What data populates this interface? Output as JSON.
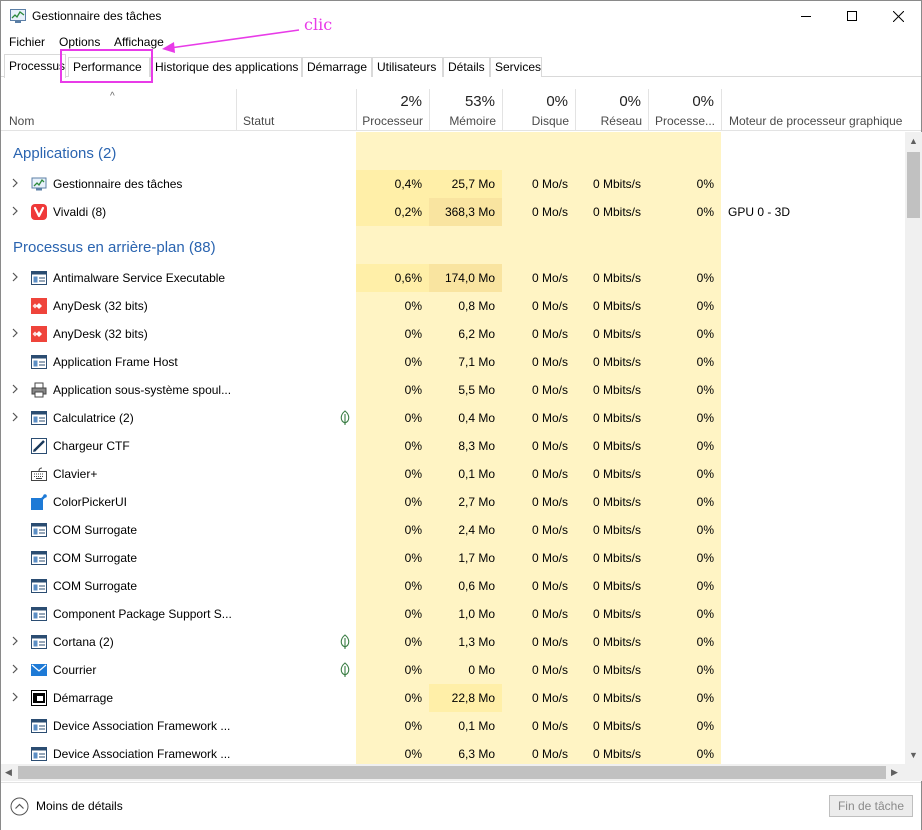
{
  "window": {
    "title": "Gestionnaire des tâches",
    "annotation_label": "clic"
  },
  "menu": [
    "Fichier",
    "Options",
    "Affichage"
  ],
  "tabs": [
    {
      "label": "Processus",
      "active": true
    },
    {
      "label": "Performance",
      "highlighted": true
    },
    {
      "label": "Historique des applications"
    },
    {
      "label": "Démarrage"
    },
    {
      "label": "Utilisateurs"
    },
    {
      "label": "Détails"
    },
    {
      "label": "Services"
    }
  ],
  "columns": {
    "name": "Nom",
    "status": "Statut",
    "cpu": {
      "pct": "2%",
      "label": "Processeur"
    },
    "memory": {
      "pct": "53%",
      "label": "Mémoire"
    },
    "disk": {
      "pct": "0%",
      "label": "Disque"
    },
    "network": {
      "pct": "0%",
      "label": "Réseau"
    },
    "gpu": {
      "pct": "0%",
      "label": "Processe..."
    },
    "gpu_engine": "Moteur de processeur graphique"
  },
  "groups": [
    {
      "label": "Applications (2)",
      "rows": [
        {
          "name": "Gestionnaire des tâches",
          "icon": "task-manager-icon",
          "expandable": true,
          "cpu": "0,4%",
          "mem": "25,7 Mo",
          "disk": "0 Mo/s",
          "net": "0 Mbits/s",
          "gpu": "0%",
          "gpu_engine": ""
        },
        {
          "name": "Vivaldi (8)",
          "icon": "vivaldi-icon",
          "expandable": true,
          "cpu": "0,2%",
          "mem": "368,3 Mo",
          "disk": "0 Mo/s",
          "net": "0 Mbits/s",
          "gpu": "0%",
          "gpu_engine": "GPU 0 - 3D"
        }
      ]
    },
    {
      "label": "Processus en arrière-plan (88)",
      "rows": [
        {
          "name": "Antimalware Service Executable",
          "icon": "service-window-icon",
          "expandable": true,
          "cpu": "0,6%",
          "mem": "174,0 Mo",
          "disk": "0 Mo/s",
          "net": "0 Mbits/s",
          "gpu": "0%"
        },
        {
          "name": "AnyDesk (32 bits)",
          "icon": "anydesk-icon",
          "expandable": false,
          "cpu": "0%",
          "mem": "0,8 Mo",
          "disk": "0 Mo/s",
          "net": "0 Mbits/s",
          "gpu": "0%"
        },
        {
          "name": "AnyDesk (32 bits)",
          "icon": "anydesk-icon",
          "expandable": true,
          "cpu": "0%",
          "mem": "6,2 Mo",
          "disk": "0 Mo/s",
          "net": "0 Mbits/s",
          "gpu": "0%"
        },
        {
          "name": "Application Frame Host",
          "icon": "service-window-icon",
          "expandable": false,
          "cpu": "0%",
          "mem": "7,1 Mo",
          "disk": "0 Mo/s",
          "net": "0 Mbits/s",
          "gpu": "0%"
        },
        {
          "name": "Application sous-système spoul...",
          "icon": "printer-icon",
          "expandable": true,
          "cpu": "0%",
          "mem": "5,5 Mo",
          "disk": "0 Mo/s",
          "net": "0 Mbits/s",
          "gpu": "0%"
        },
        {
          "name": "Calculatrice (2)",
          "icon": "service-window-icon",
          "expandable": true,
          "suspended": true,
          "cpu": "0%",
          "mem": "0,4 Mo",
          "disk": "0 Mo/s",
          "net": "0 Mbits/s",
          "gpu": "0%"
        },
        {
          "name": "Chargeur CTF",
          "icon": "pen-icon",
          "expandable": false,
          "cpu": "0%",
          "mem": "8,3 Mo",
          "disk": "0 Mo/s",
          "net": "0 Mbits/s",
          "gpu": "0%"
        },
        {
          "name": "Clavier+",
          "icon": "keyboard-icon",
          "expandable": false,
          "cpu": "0%",
          "mem": "0,1 Mo",
          "disk": "0 Mo/s",
          "net": "0 Mbits/s",
          "gpu": "0%"
        },
        {
          "name": "ColorPickerUI",
          "icon": "color-picker-icon",
          "expandable": false,
          "cpu": "0%",
          "mem": "2,7 Mo",
          "disk": "0 Mo/s",
          "net": "0 Mbits/s",
          "gpu": "0%"
        },
        {
          "name": "COM Surrogate",
          "icon": "service-window-icon",
          "expandable": false,
          "cpu": "0%",
          "mem": "2,4 Mo",
          "disk": "0 Mo/s",
          "net": "0 Mbits/s",
          "gpu": "0%"
        },
        {
          "name": "COM Surrogate",
          "icon": "service-window-icon",
          "expandable": false,
          "cpu": "0%",
          "mem": "1,7 Mo",
          "disk": "0 Mo/s",
          "net": "0 Mbits/s",
          "gpu": "0%"
        },
        {
          "name": "COM Surrogate",
          "icon": "service-window-icon",
          "expandable": false,
          "cpu": "0%",
          "mem": "0,6 Mo",
          "disk": "0 Mo/s",
          "net": "0 Mbits/s",
          "gpu": "0%"
        },
        {
          "name": "Component Package Support S...",
          "icon": "service-window-icon",
          "expandable": false,
          "cpu": "0%",
          "mem": "1,0 Mo",
          "disk": "0 Mo/s",
          "net": "0 Mbits/s",
          "gpu": "0%"
        },
        {
          "name": "Cortana (2)",
          "icon": "service-window-icon",
          "expandable": true,
          "suspended": true,
          "cpu": "0%",
          "mem": "1,3 Mo",
          "disk": "0 Mo/s",
          "net": "0 Mbits/s",
          "gpu": "0%"
        },
        {
          "name": "Courrier",
          "icon": "mail-icon",
          "expandable": true,
          "suspended": true,
          "cpu": "0%",
          "mem": "0 Mo",
          "disk": "0 Mo/s",
          "net": "0 Mbits/s",
          "gpu": "0%"
        },
        {
          "name": "Démarrage",
          "icon": "startup-icon",
          "expandable": true,
          "cpu": "0%",
          "mem": "22,8 Mo",
          "disk": "0 Mo/s",
          "net": "0 Mbits/s",
          "gpu": "0%"
        },
        {
          "name": "Device Association Framework ...",
          "icon": "service-window-icon",
          "expandable": false,
          "cpu": "0%",
          "mem": "0,1 Mo",
          "disk": "0 Mo/s",
          "net": "0 Mbits/s",
          "gpu": "0%"
        },
        {
          "name": "Device Association Framework ...",
          "icon": "service-window-icon",
          "expandable": false,
          "cpu": "0%",
          "mem": "6,3 Mo",
          "disk": "0 Mo/s",
          "net": "0 Mbits/s",
          "gpu": "0%"
        }
      ]
    }
  ],
  "footer": {
    "fewer_details": "Moins de détails",
    "end_task": "Fin de tâche"
  },
  "colors": {
    "heat_light": "#fff4c4",
    "heat_mid": "#ffefa8",
    "heat_high": "#f9e4a0",
    "group_text": "#2a64b0",
    "annotation": "#e83be8"
  }
}
